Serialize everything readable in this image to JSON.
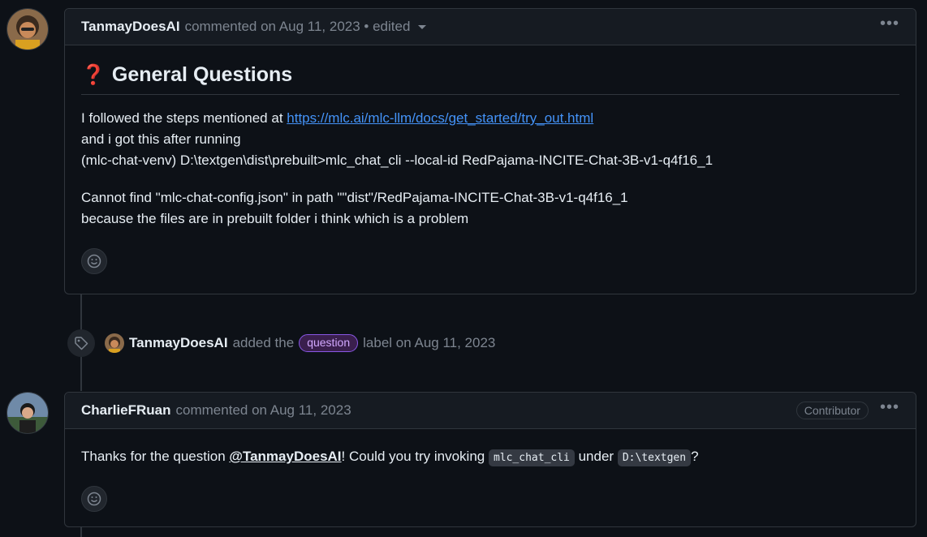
{
  "comment1": {
    "author": "TanmayDoesAI",
    "meta": "commented on Aug 11, 2023 • edited",
    "heading_emoji": "❓",
    "heading": "General Questions",
    "line1_prefix": "I followed the steps mentioned at ",
    "line1_link": "https://mlc.ai/mlc-llm/docs/get_started/try_out.html",
    "line2": "and i got this after running",
    "line3": "(mlc-chat-venv) D:\\textgen\\dist\\prebuilt>mlc_chat_cli --local-id RedPajama-INCITE-Chat-3B-v1-q4f16_1",
    "line4": "Cannot find \"mlc-chat-config.json\" in path \"\"dist\"/RedPajama-INCITE-Chat-3B-v1-q4f16_1",
    "line5": "because the files are in prebuilt folder i think which is a problem",
    "menu": "•••"
  },
  "event": {
    "actor": "TanmayDoesAI",
    "text_before": "added the",
    "label": "question",
    "text_after": "label on Aug 11, 2023"
  },
  "comment2": {
    "author": "CharlieFRuan",
    "meta": "commented on Aug 11, 2023",
    "badge": "Contributor",
    "menu": "•••",
    "text1": "Thanks for the question ",
    "mention": "@TanmayDoesAI",
    "text2": "! Could you try invoking ",
    "code1": "mlc_chat_cli",
    "text3": " under ",
    "code2": "D:\\textgen",
    "text4": "?"
  }
}
